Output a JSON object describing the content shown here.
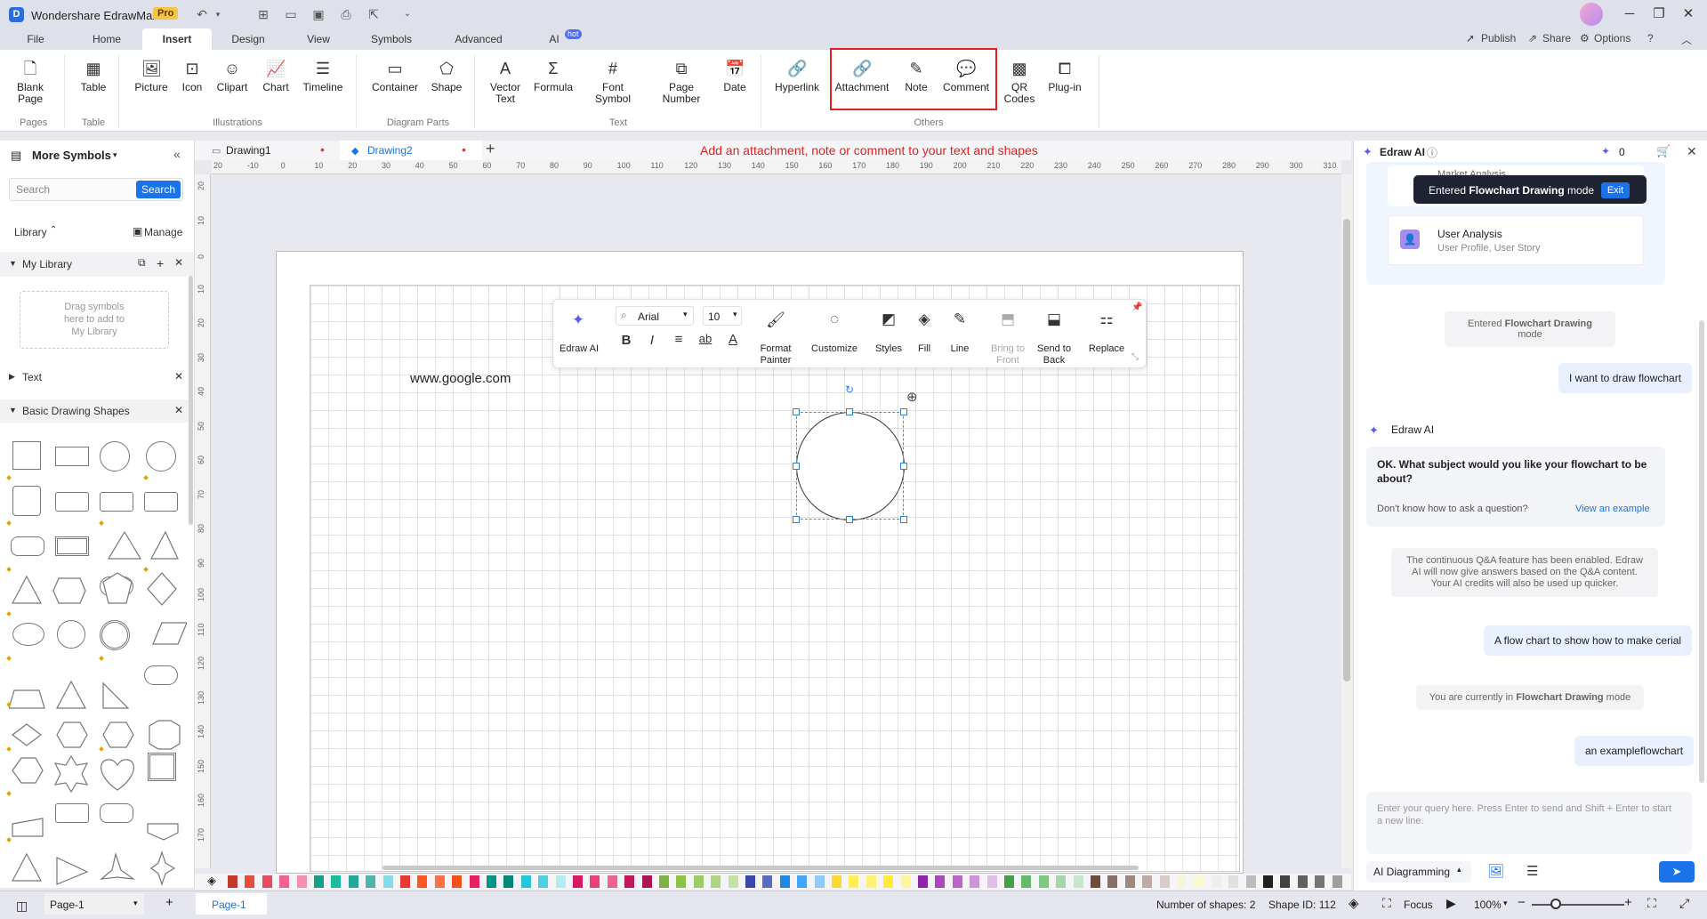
{
  "app": {
    "name": "Wondershare EdrawMax",
    "badge": "Pro"
  },
  "menu": {
    "tabs": [
      "File",
      "Home",
      "Insert",
      "Design",
      "View",
      "Symbols",
      "Advanced",
      "AI"
    ],
    "ai_badge": "hot",
    "right": {
      "publish": "Publish",
      "share": "Share",
      "options": "Options"
    }
  },
  "ribbon": {
    "buttons": {
      "blank_page": "Blank Page",
      "table": "Table",
      "picture": "Picture",
      "icon": "Icon",
      "clipart": "Clipart",
      "chart": "Chart",
      "timeline": "Timeline",
      "container": "Container",
      "shape": "Shape",
      "vector_text": "Vector Text",
      "formula": "Formula",
      "font_symbol": "Font Symbol",
      "page_number": "Page Number",
      "date": "Date",
      "hyperlink": "Hyperlink",
      "attachment": "Attachment",
      "note": "Note",
      "comment": "Comment",
      "qr_codes": "QR Codes",
      "plugin": "Plug-in"
    },
    "groups": {
      "pages": "Pages",
      "table": "Table",
      "illustrations": "Illustrations",
      "diagram_parts": "Diagram Parts",
      "text": "Text",
      "others": "Others"
    }
  },
  "left_panel": {
    "title": "More Symbols",
    "search_placeholder": "Search",
    "search_button": "Search",
    "library_label": "Library",
    "manage": "Manage",
    "my_library": "My Library",
    "drag_hint_1": "Drag symbols",
    "drag_hint_2": "here to add to",
    "drag_hint_3": "My Library",
    "text_section": "Text",
    "basic_shapes": "Basic Drawing Shapes"
  },
  "doc_tabs": [
    "Drawing1",
    "Drawing2"
  ],
  "annotation": "Add an attachment, note or comment to your text and shapes",
  "ruler_h": [
    "20",
    "-10",
    "0",
    "10",
    "20",
    "30",
    "40",
    "50",
    "60",
    "70",
    "80",
    "90",
    "100",
    "110",
    "120",
    "130",
    "140",
    "150",
    "160",
    "170",
    "180",
    "190",
    "200",
    "210",
    "220",
    "230",
    "240",
    "250",
    "260",
    "270",
    "280",
    "290",
    "300",
    "310"
  ],
  "ruler_v": [
    "20",
    "10",
    "0",
    "10",
    "20",
    "30",
    "40",
    "50",
    "60",
    "70",
    "80",
    "90",
    "100",
    "110",
    "120",
    "130",
    "140",
    "150",
    "160",
    "170"
  ],
  "canvas": {
    "text_on_canvas": "www.google.com"
  },
  "floatbar": {
    "edraw_ai": "Edraw AI",
    "font": "Arial",
    "size": "10",
    "format_painter": "Format Painter",
    "customize": "Customize",
    "styles": "Styles",
    "fill": "Fill",
    "line": "Line",
    "bring_to_front": "Bring to Front",
    "send_to_back": "Send to Back",
    "replace": "Replace"
  },
  "status": {
    "page_selector": "Page-1",
    "page_tab": "Page-1",
    "num_shapes": "Number of shapes: 2",
    "shape_id": "Shape ID: 112",
    "focus": "Focus",
    "zoom": "100%"
  },
  "ai_panel": {
    "title": "Edraw AI",
    "credits": "0",
    "card_partial": "Market Analysis",
    "card_title": "User Analysis",
    "card_sub": "User Profile, User Story",
    "tooltip_prefix": "Entered ",
    "tooltip_bold": "Flowchart Drawing",
    "tooltip_suffix": " mode",
    "exit": "Exit",
    "sys1_prefix": "Entered ",
    "sys1_bold": "Flowchart Drawing",
    "sys1_suffix": " mode",
    "user1": "I want to draw flowchart",
    "ai_name": "Edraw AI",
    "ai_question": "OK. What subject would you like your flowchart to be about?",
    "ai_hint": "Don't know how to ask a question?",
    "ai_link": "View an example",
    "sys2": "The continuous Q&A feature has been enabled. Edraw AI will now give answers based on the Q&A content. Your AI credits will also be used up quicker.",
    "user2": "A flow chart to show how to make cerial",
    "sys3_prefix": "You are currently in ",
    "sys3_bold": "Flowchart Drawing",
    "sys3_suffix": " mode",
    "user3": "an exampleflowchart",
    "query_placeholder": "Enter your query here. Press Enter to send and Shift + Enter to start a new line.",
    "mode_select": "AI Diagramming"
  },
  "palette_colors": [
    "#c0392b",
    "#e74c3c",
    "#e84a5f",
    "#f06292",
    "#f48fb1",
    "#16a085",
    "#1abc9c",
    "#26a69a",
    "#4db6ac",
    "#80deea",
    "#e53935",
    "#ff5722",
    "#ff7043",
    "#f4511e",
    "#e91e63",
    "#009688",
    "#00897b",
    "#26c6da",
    "#4dd0e1",
    "#b2ebf2",
    "#d81b60",
    "#ec407a",
    "#f06292",
    "#c2185b",
    "#ad1457",
    "#7cb342",
    "#8bc34a",
    "#9ccc65",
    "#aed581",
    "#c5e1a5",
    "#3949ab",
    "#5c6bc0",
    "#1e88e5",
    "#42a5f5",
    "#90caf9",
    "#fdd835",
    "#ffee58",
    "#fff176",
    "#ffeb3b",
    "#fff59d",
    "#8e24aa",
    "#ab47bc",
    "#ba68c8",
    "#ce93d8",
    "#e1bee7",
    "#43a047",
    "#66bb6a",
    "#81c784",
    "#a5d6a7",
    "#c8e6c9",
    "#6d4c41",
    "#8d6e63",
    "#a1887f",
    "#bcaaa4",
    "#d7ccc8",
    "#f5f5dc",
    "#fafad2",
    "#eeeeee",
    "#e0e0e0",
    "#bdbdbd",
    "#212121",
    "#424242",
    "#616161",
    "#757575",
    "#9e9e9e"
  ]
}
